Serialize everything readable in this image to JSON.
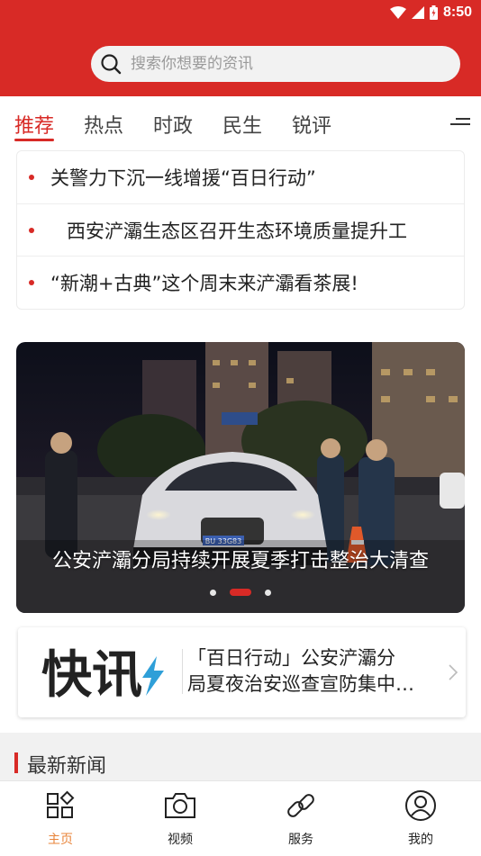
{
  "status": {
    "time": "8:50"
  },
  "search": {
    "placeholder": "搜索你想要的资讯"
  },
  "tabs": [
    {
      "label": "推荐"
    },
    {
      "label": "热点"
    },
    {
      "label": "时政"
    },
    {
      "label": "民生"
    },
    {
      "label": "锐评"
    }
  ],
  "headlines": [
    {
      "text": "关警力下沉一线增援“百日行动”"
    },
    {
      "text": "西安浐灞生态区召开生态环境质量提升工"
    },
    {
      "text": "“新潮+古典”这个周末来浐灞看茶展!"
    }
  ],
  "carousel": {
    "caption": "公安浐灞分局持续开展夏季打击整治大清查",
    "plate": "BU 33G83",
    "slide_count": 3,
    "active_index": 1
  },
  "flash": {
    "logo_text": "快讯",
    "line1": "「百日行动」公安浐灞分",
    "line2": "局夏夜治安巡查宣防集中…"
  },
  "section": {
    "title": "最新新闻"
  },
  "bottom_nav": [
    {
      "label": "主页"
    },
    {
      "label": "视频"
    },
    {
      "label": "服务"
    },
    {
      "label": "我的"
    }
  ],
  "colors": {
    "brand": "#d82a26",
    "nav_active": "#e8843a"
  }
}
